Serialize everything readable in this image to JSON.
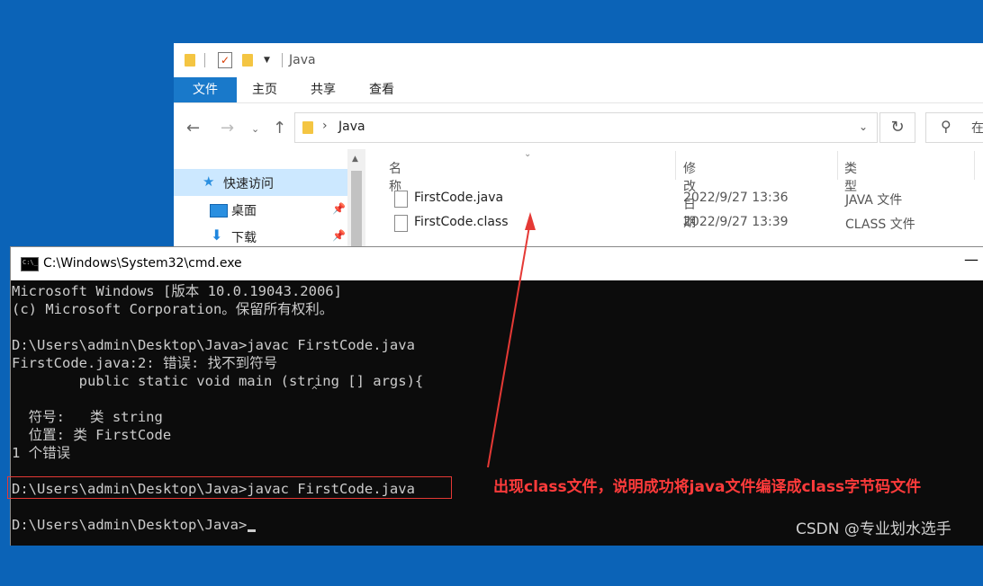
{
  "explorer": {
    "qat_title": "Java",
    "ribbon_tabs": [
      "文件",
      "主页",
      "共享",
      "查看"
    ],
    "breadcrumb": "Java",
    "search_placeholder": "在",
    "nav_items": [
      {
        "label": "快速访问",
        "icon": "star-icon"
      },
      {
        "label": "桌面",
        "icon": "desktop-icon"
      },
      {
        "label": "下载",
        "icon": "download-icon"
      }
    ],
    "columns": {
      "name": "名称",
      "date": "修改日期",
      "type": "类型"
    },
    "files": [
      {
        "name": "FirstCode.java",
        "date": "2022/9/27 13:36",
        "type": "JAVA 文件"
      },
      {
        "name": "FirstCode.class",
        "date": "2022/9/27 13:39",
        "type": "CLASS 文件"
      }
    ]
  },
  "cmd": {
    "title": "C:\\Windows\\System32\\cmd.exe",
    "lines": [
      "Microsoft Windows [版本 10.0.19043.2006]",
      "(c) Microsoft Corporation。保留所有权利。",
      "",
      "D:\\Users\\admin\\Desktop\\Java>javac FirstCode.java",
      "FirstCode.java:2: 错误: 找不到符号",
      "        public static void main (string [] args){",
      "",
      "  符号:   类 string",
      "  位置: 类 FirstCode",
      "1 个错误",
      "",
      "D:\\Users\\admin\\Desktop\\Java>javac FirstCode.java",
      "",
      "D:\\Users\\admin\\Desktop\\Java>"
    ],
    "caret_symbol": "^"
  },
  "annotation": {
    "text": "出现class文件，说明成功将java文件编译成class字节码文件",
    "color": "#ff3b3b"
  },
  "watermark": "CSDN @专业划水选手",
  "colors": {
    "desktop": "#0b63b7",
    "ribbon_active": "#1979ca",
    "console_bg": "#0c0c0c",
    "console_fg": "#cccccc"
  }
}
